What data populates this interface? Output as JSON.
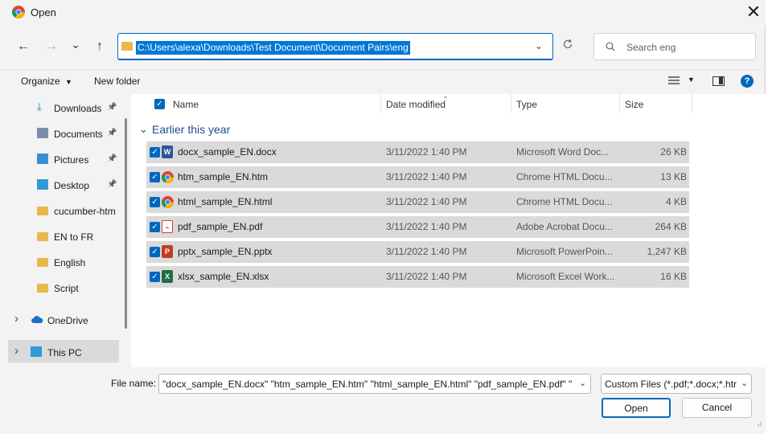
{
  "window": {
    "title": "Open",
    "close_label": "✕"
  },
  "nav": {
    "back": "←",
    "forward": "→",
    "recent": "⌄",
    "up": "↑"
  },
  "address": {
    "path": "C:\\Users\\alexa\\Downloads\\Test Document\\Document Pairs\\eng"
  },
  "search": {
    "placeholder": "Search eng"
  },
  "toolbar": {
    "organize": "Organize",
    "new_folder": "New folder"
  },
  "sidebar": {
    "items": [
      {
        "label": "Downloads",
        "icon": "download-icon",
        "pinned": true
      },
      {
        "label": "Documents",
        "icon": "documents-icon",
        "pinned": true
      },
      {
        "label": "Pictures",
        "icon": "pictures-icon",
        "pinned": true
      },
      {
        "label": "Desktop",
        "icon": "desktop-icon",
        "pinned": true
      },
      {
        "label": "cucumber-htm",
        "icon": "folder-icon",
        "pinned": false
      },
      {
        "label": "EN to FR",
        "icon": "folder-icon",
        "pinned": false
      },
      {
        "label": "English",
        "icon": "folder-icon",
        "pinned": false
      },
      {
        "label": "Script",
        "icon": "folder-icon",
        "pinned": false
      },
      {
        "label": "OneDrive",
        "icon": "cloud-icon",
        "pinned": false
      },
      {
        "label": "This PC",
        "icon": "pc-icon",
        "pinned": false
      }
    ]
  },
  "columns": {
    "name": "Name",
    "date": "Date modified",
    "type": "Type",
    "size": "Size"
  },
  "group": {
    "label": "Earlier this year"
  },
  "files": [
    {
      "name": "docx_sample_EN.docx",
      "date": "3/11/2022 1:40 PM",
      "type": "Microsoft Word Doc...",
      "size": "26 KB",
      "icon": "word-icon"
    },
    {
      "name": "htm_sample_EN.htm",
      "date": "3/11/2022 1:40 PM",
      "type": "Chrome HTML Docu...",
      "size": "13 KB",
      "icon": "chrome-icon"
    },
    {
      "name": "html_sample_EN.html",
      "date": "3/11/2022 1:40 PM",
      "type": "Chrome HTML Docu...",
      "size": "4 KB",
      "icon": "chrome-icon"
    },
    {
      "name": "pdf_sample_EN.pdf",
      "date": "3/11/2022 1:40 PM",
      "type": "Adobe Acrobat Docu...",
      "size": "264 KB",
      "icon": "pdf-icon"
    },
    {
      "name": "pptx_sample_EN.pptx",
      "date": "3/11/2022 1:40 PM",
      "type": "Microsoft PowerPoin...",
      "size": "1,247 KB",
      "icon": "powerpoint-icon"
    },
    {
      "name": "xlsx_sample_EN.xlsx",
      "date": "3/11/2022 1:40 PM",
      "type": "Microsoft Excel Work...",
      "size": "16 KB",
      "icon": "excel-icon"
    }
  ],
  "footer": {
    "file_name_label": "File name:",
    "file_name_value": "\"docx_sample_EN.docx\" \"htm_sample_EN.htm\" \"html_sample_EN.html\" \"pdf_sample_EN.pdf\" \"pp",
    "filter_value": "Custom Files (*.pdf;*.docx;*.htr",
    "open_label": "Open",
    "cancel_label": "Cancel"
  },
  "colors": {
    "accent": "#0067c0",
    "selection": "#0078d7",
    "row_selected": "#dadada"
  }
}
